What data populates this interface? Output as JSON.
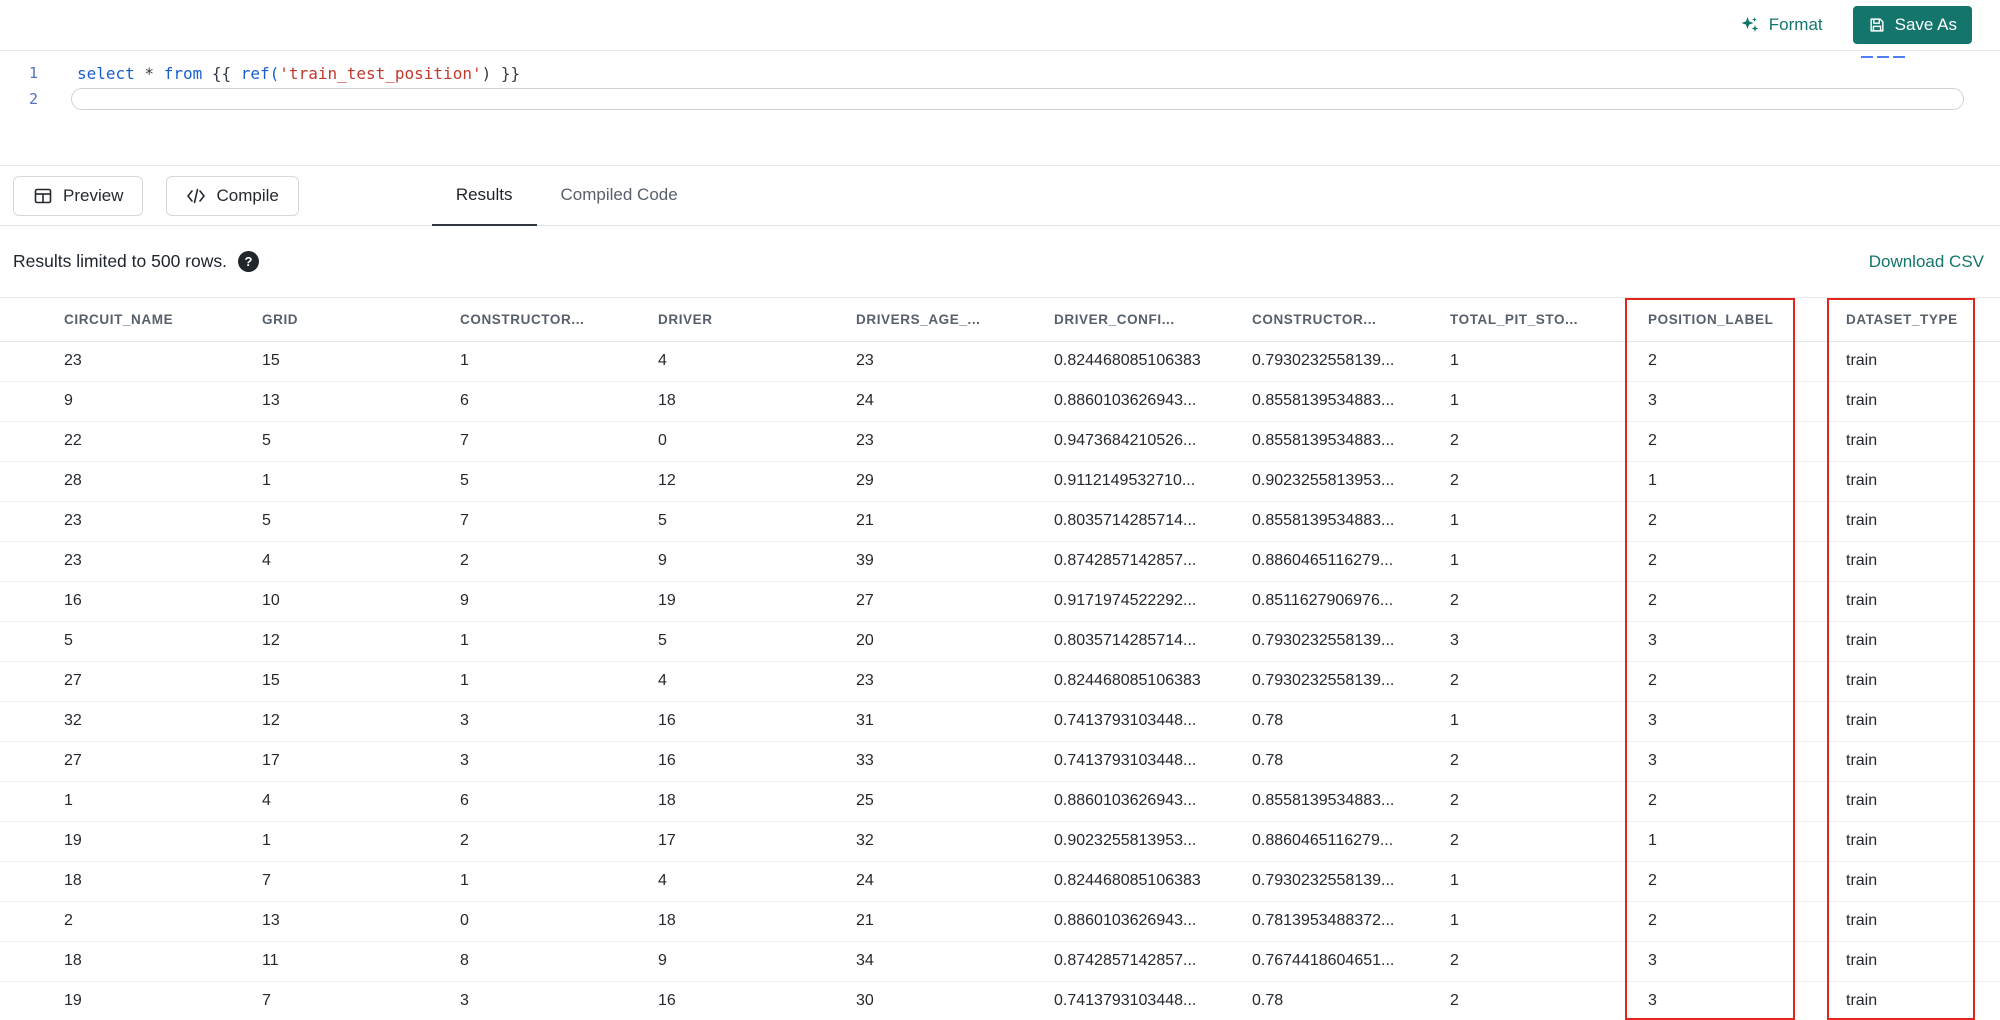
{
  "topbar": {
    "format_label": "Format",
    "save_as_label": "Save As"
  },
  "editor": {
    "line_numbers": [
      "1",
      "2"
    ],
    "tokens": [
      {
        "text": "select",
        "type": "keyword"
      },
      {
        "text": " * ",
        "type": "plain"
      },
      {
        "text": "from",
        "type": "keyword"
      },
      {
        "text": " {{ ",
        "type": "plain"
      },
      {
        "text": "ref(",
        "type": "keyword"
      },
      {
        "text": "'train_test_position'",
        "type": "string"
      },
      {
        "text": ") }}",
        "type": "plain"
      }
    ]
  },
  "actions": {
    "preview_label": "Preview",
    "compile_label": "Compile"
  },
  "tabs": [
    {
      "label": "Results",
      "active": true
    },
    {
      "label": "Compiled Code",
      "active": false
    }
  ],
  "results": {
    "limit_text": "Results limited to 500 rows.",
    "help_glyph": "?",
    "download_label": "Download CSV"
  },
  "table": {
    "columns": [
      "CIRCUIT_NAME",
      "GRID",
      "CONSTRUCTOR...",
      "DRIVER",
      "DRIVERS_AGE_...",
      "DRIVER_CONFI...",
      "CONSTRUCTOR...",
      "TOTAL_PIT_STO...",
      "POSITION_LABEL",
      "DATASET_TYPE"
    ],
    "highlighted_columns": [
      "POSITION_LABEL",
      "DATASET_TYPE"
    ],
    "rows": [
      [
        "23",
        "15",
        "1",
        "4",
        "23",
        "0.824468085106383",
        "0.7930232558139...",
        "1",
        "2",
        "train"
      ],
      [
        "9",
        "13",
        "6",
        "18",
        "24",
        "0.8860103626943...",
        "0.8558139534883...",
        "1",
        "3",
        "train"
      ],
      [
        "22",
        "5",
        "7",
        "0",
        "23",
        "0.9473684210526...",
        "0.8558139534883...",
        "2",
        "2",
        "train"
      ],
      [
        "28",
        "1",
        "5",
        "12",
        "29",
        "0.9112149532710...",
        "0.9023255813953...",
        "2",
        "1",
        "train"
      ],
      [
        "23",
        "5",
        "7",
        "5",
        "21",
        "0.8035714285714...",
        "0.8558139534883...",
        "1",
        "2",
        "train"
      ],
      [
        "23",
        "4",
        "2",
        "9",
        "39",
        "0.8742857142857...",
        "0.8860465116279...",
        "1",
        "2",
        "train"
      ],
      [
        "16",
        "10",
        "9",
        "19",
        "27",
        "0.9171974522292...",
        "0.8511627906976...",
        "2",
        "2",
        "train"
      ],
      [
        "5",
        "12",
        "1",
        "5",
        "20",
        "0.8035714285714...",
        "0.7930232558139...",
        "3",
        "3",
        "train"
      ],
      [
        "27",
        "15",
        "1",
        "4",
        "23",
        "0.824468085106383",
        "0.7930232558139...",
        "2",
        "2",
        "train"
      ],
      [
        "32",
        "12",
        "3",
        "16",
        "31",
        "0.7413793103448...",
        "0.78",
        "1",
        "3",
        "train"
      ],
      [
        "27",
        "17",
        "3",
        "16",
        "33",
        "0.7413793103448...",
        "0.78",
        "2",
        "3",
        "train"
      ],
      [
        "1",
        "4",
        "6",
        "18",
        "25",
        "0.8860103626943...",
        "0.8558139534883...",
        "2",
        "2",
        "train"
      ],
      [
        "19",
        "1",
        "2",
        "17",
        "32",
        "0.9023255813953...",
        "0.8860465116279...",
        "2",
        "1",
        "train"
      ],
      [
        "18",
        "7",
        "1",
        "4",
        "24",
        "0.824468085106383",
        "0.7930232558139...",
        "1",
        "2",
        "train"
      ],
      [
        "2",
        "13",
        "0",
        "18",
        "21",
        "0.8860103626943...",
        "0.7813953488372...",
        "1",
        "2",
        "train"
      ],
      [
        "18",
        "11",
        "8",
        "9",
        "34",
        "0.8742857142857...",
        "0.7674418604651...",
        "2",
        "3",
        "train"
      ],
      [
        "19",
        "7",
        "3",
        "16",
        "30",
        "0.7413793103448...",
        "0.78",
        "2",
        "3",
        "train"
      ]
    ]
  },
  "colors": {
    "accent_teal": "#13756B",
    "highlight_red": "#E3261D"
  }
}
